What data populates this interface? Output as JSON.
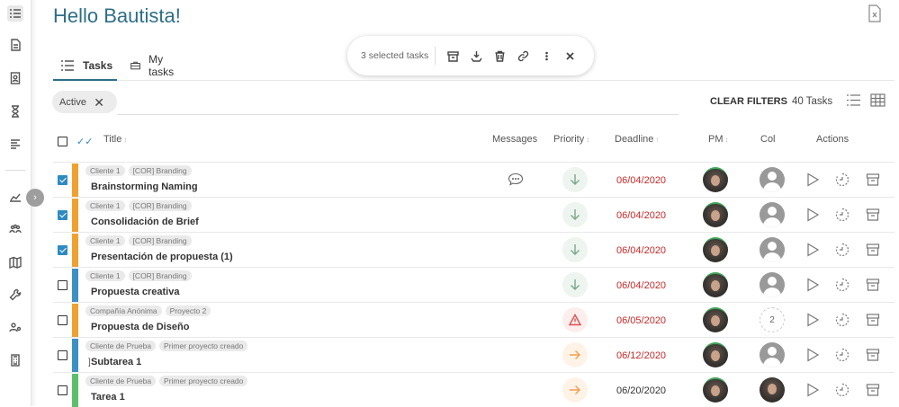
{
  "header": {
    "greeting": "Hello Bautista!"
  },
  "tabs": [
    {
      "label": "Tasks",
      "icon": "list-icon",
      "active": true
    },
    {
      "label": "My tasks",
      "icon": "briefcase-icon",
      "active": false
    }
  ],
  "selection_bar": {
    "count_label": "3 selected tasks",
    "actions": [
      "archive-icon",
      "priority-icon",
      "delete-icon",
      "link-icon",
      "more-icon",
      "close-icon"
    ]
  },
  "filters": {
    "chip_label": "Active",
    "clear_label": "CLEAR FILTERS",
    "task_count": "40 Tasks"
  },
  "columns": {
    "title": "Title",
    "messages": "Messages",
    "priority": "Priority",
    "deadline": "Deadline",
    "pm": "PM",
    "col": "Col",
    "actions": "Actions"
  },
  "colors": {
    "accent": "#2e6f86",
    "orange": "#f0a030",
    "blue": "#3d8fc6",
    "green": "#5cc06a",
    "overdue": "#c62828"
  },
  "rows": [
    {
      "checked": true,
      "tags": [
        "Cliente 1",
        "[COR] Branding"
      ],
      "name": "Brainstorming Naming",
      "messages": true,
      "priority": "low",
      "deadline": "06/04/2020",
      "overdue": true,
      "bar": "orange",
      "col": "avatar"
    },
    {
      "checked": true,
      "tags": [
        "Cliente 1",
        "[COR] Branding"
      ],
      "name": "Consolidación de Brief",
      "messages": false,
      "priority": "low",
      "deadline": "06/04/2020",
      "overdue": true,
      "bar": "orange",
      "col": "avatar"
    },
    {
      "checked": true,
      "tags": [
        "Cliente 1",
        "[COR] Branding"
      ],
      "name": "Presentación de propuesta (1)",
      "messages": false,
      "priority": "low",
      "deadline": "06/04/2020",
      "overdue": true,
      "bar": "orange",
      "col": "avatar"
    },
    {
      "checked": false,
      "tags": [
        "Cliente 1",
        "[COR] Branding"
      ],
      "name": "Propuesta creativa",
      "messages": false,
      "priority": "low",
      "deadline": "06/04/2020",
      "overdue": true,
      "bar": "blue",
      "col": "avatar"
    },
    {
      "checked": false,
      "tags": [
        "Compañía Anónima",
        "Proyecto 2"
      ],
      "name": "Propuesta de Diseño",
      "messages": false,
      "priority": "high",
      "deadline": "06/05/2020",
      "overdue": true,
      "bar": "orange",
      "col": "2"
    },
    {
      "checked": false,
      "tags": [
        "Cliente de Prueba",
        "Primer proyecto creado"
      ],
      "name": "Subtarea 1",
      "messages": false,
      "priority": "med",
      "deadline": "06/12/2020",
      "overdue": true,
      "bar": "blue",
      "col": "avatar",
      "subtask": true
    },
    {
      "checked": false,
      "tags": [
        "Cliente de Prueba",
        "Primer proyecto creado"
      ],
      "name": "Tarea 1",
      "messages": false,
      "priority": "med",
      "deadline": "06/20/2020",
      "overdue": false,
      "bar": "green",
      "col": "photo"
    }
  ]
}
